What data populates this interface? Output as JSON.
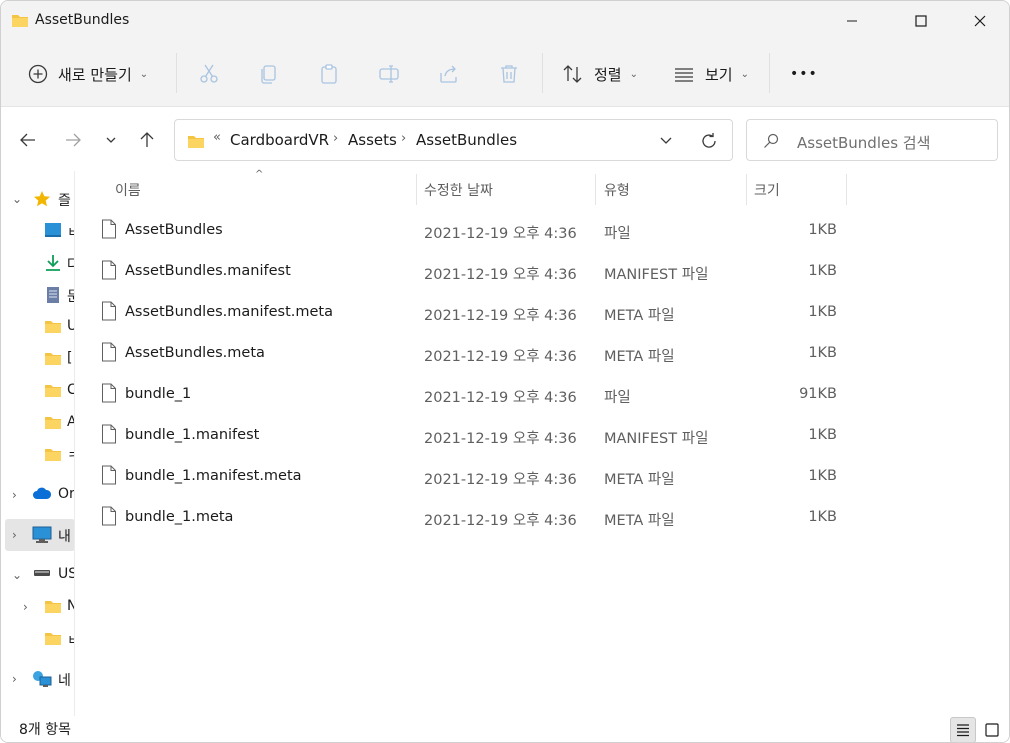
{
  "window": {
    "title": "AssetBundles"
  },
  "commandbar": {
    "new_label": "새로 만들기",
    "sort_label": "정렬",
    "view_label": "보기",
    "more_label": "•••"
  },
  "address": {
    "overflow": "«",
    "crumbs": [
      "CardboardVR",
      "Assets",
      "AssetBundles"
    ],
    "separator": "›"
  },
  "search": {
    "placeholder": "AssetBundles 검색"
  },
  "sidebar": {
    "items": [
      {
        "label": "즐",
        "icon": "star-icon"
      },
      {
        "label": "ㅂ",
        "icon": "desktop-icon"
      },
      {
        "label": "다",
        "icon": "download-icon"
      },
      {
        "label": "문",
        "icon": "document-icon"
      },
      {
        "label": "U",
        "icon": "folder-icon"
      },
      {
        "label": "[",
        "icon": "folder-icon"
      },
      {
        "label": "C",
        "icon": "folder-icon"
      },
      {
        "label": "A",
        "icon": "folder-icon"
      },
      {
        "label": "ㅋ",
        "icon": "folder-icon"
      },
      {
        "label": "Or",
        "icon": "onedrive-icon"
      },
      {
        "label": "내",
        "icon": "pc-icon"
      },
      {
        "label": "US",
        "icon": "drive-icon"
      },
      {
        "label": "N",
        "icon": "folder-icon"
      },
      {
        "label": "ㅂ",
        "icon": "folder-icon"
      },
      {
        "label": "네",
        "icon": "network-icon"
      }
    ]
  },
  "columns": {
    "name": "이름",
    "date": "수정한 날짜",
    "type": "유형",
    "size": "크기"
  },
  "files": [
    {
      "name": "AssetBundles",
      "date": "2021-12-19 오후 4:36",
      "type": "파일",
      "size": "1KB"
    },
    {
      "name": "AssetBundles.manifest",
      "date": "2021-12-19 오후 4:36",
      "type": "MANIFEST 파일",
      "size": "1KB"
    },
    {
      "name": "AssetBundles.manifest.meta",
      "date": "2021-12-19 오후 4:36",
      "type": "META 파일",
      "size": "1KB"
    },
    {
      "name": "AssetBundles.meta",
      "date": "2021-12-19 오후 4:36",
      "type": "META 파일",
      "size": "1KB"
    },
    {
      "name": "bundle_1",
      "date": "2021-12-19 오후 4:36",
      "type": "파일",
      "size": "91KB"
    },
    {
      "name": "bundle_1.manifest",
      "date": "2021-12-19 오후 4:36",
      "type": "MANIFEST 파일",
      "size": "1KB"
    },
    {
      "name": "bundle_1.manifest.meta",
      "date": "2021-12-19 오후 4:36",
      "type": "META 파일",
      "size": "1KB"
    },
    {
      "name": "bundle_1.meta",
      "date": "2021-12-19 오후 4:36",
      "type": "META 파일",
      "size": "1KB"
    }
  ],
  "status": {
    "item_count": "8개 항목"
  },
  "colors": {
    "folder": "#f4c542",
    "accent": "#0067c0",
    "chrome": "#f3f3f3"
  }
}
